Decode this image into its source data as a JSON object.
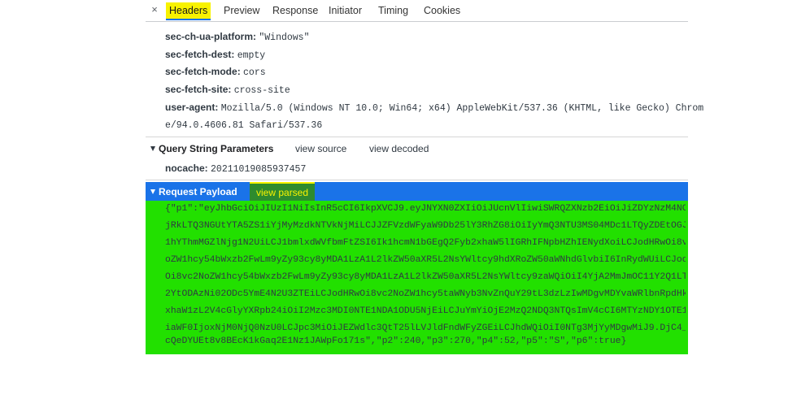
{
  "tabs": {
    "close": "×",
    "items": [
      "Headers",
      "Preview",
      "Response",
      "Initiator",
      "Timing",
      "Cookies"
    ]
  },
  "headers": [
    {
      "key": "sec-ch-ua-platform:",
      "value": "\"Windows\""
    },
    {
      "key": "sec-fetch-dest:",
      "value": "empty"
    },
    {
      "key": "sec-fetch-mode:",
      "value": "cors"
    },
    {
      "key": "sec-fetch-site:",
      "value": "cross-site"
    },
    {
      "key": "user-agent:",
      "value": "Mozilla/5.0 (Windows NT 10.0; Win64; x64) AppleWebKit/537.36 (KHTML, like Gecko) Chrom"
    }
  ],
  "user_agent_cont": "e/94.0.4606.81 Safari/537.36",
  "query": {
    "title": "Query String Parameters",
    "view_source": "view source",
    "view_decoded": "view decoded",
    "key": "nocache:",
    "value": "20211019085937457"
  },
  "payload": {
    "title": "Request Payload",
    "view_parsed": "view parsed",
    "lines": [
      "{\"p1\":\"eyJhbGciOiJIUzI1NiIsInR5cCI6IkpXVCJ9.eyJNYXN0ZXIiOiJUcnVlIiwiSWRQZXNzb2EiOiJiZDYzNzM4NC05Y",
      "jRkLTQ3NGUtYTA5ZS1iYjMyMzdkNTVkNjMiLCJJZFVzdWFyaW9Db25lY3RhZG8iOiIyYmQ3NTU3MS04MDc1LTQyZDEtOGJlYS",
      "1hYThmMGZlNjg1N2UiLCJ1bmlxdWVfbmFtZSI6Ik1hcmN1bGEgQ2Fyb2xhaW5lIGRhIFNpbHZhIENydXoiLCJodHRwOi8vc2N",
      "oZW1hcy54bWxzb2FwLm9yZy93cy8yMDA1LzA1L2lkZW50aXR5L2NsYWltcy9hdXRoZW50aWNhdGlvbiI6InRydWUiLCJodHRw",
      "Oi8vc2NoZW1hcy54bWxzb2FwLm9yZy93cy8yMDA1LzA1L2lkZW50aXR5L2NsYWltcy9zaWQiOiI4YjA2MmJmOC11Y2Q1LTQ1Y",
      "2YtODAzNi02ODc5YmE4N2U3ZTEiLCJodHRwOi8vc2NoZW1hcy5taWNyb3NvZnQuY29tL3dzLzIwMDgvMDYvaWRlbnRpdHkvY2",
      "xhaW1zL2V4cGlyYXRpb24iOiI2Mzc3MDI0NTE1NDA1ODU5NjEiLCJuYmYiOjE2MzQ2NDQ3NTQsImV4cCI6MTYzNDY1OTE1NCw",
      "iaWF0IjoxNjM0NjQ0NzU0LCJpc3MiOiJEZWdlc3QtT25lLVJldFndWFyZGEiLCJhdWQiOiI0NTg3MjYyMDgwMiJ9.DjC4_6k",
      "cQeDYUEt8v8BEcK1kGaq2E1Nz1JAWpFo171s\",\"p2\":240,\"p3\":270,\"p4\":52,\"p5\":\"S\",\"p6\":true}"
    ]
  }
}
